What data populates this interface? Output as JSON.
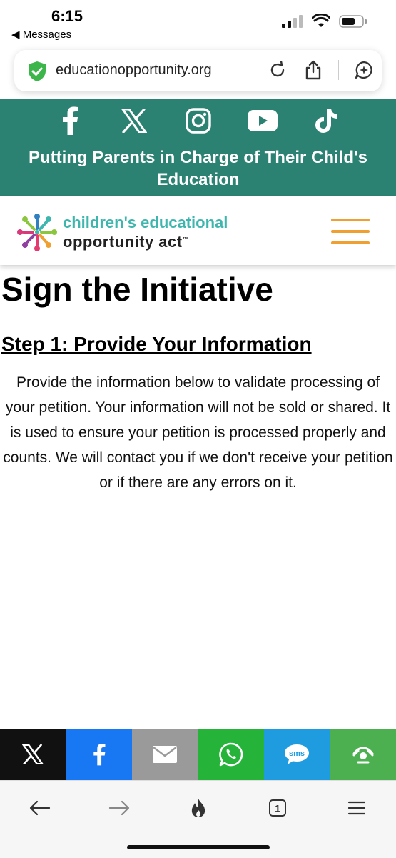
{
  "status": {
    "time": "6:15",
    "back_label": "◀ Messages",
    "battery_color": "#111111"
  },
  "browser": {
    "url": "educationopportunity.org",
    "icons": [
      "shield-check-icon",
      "reload-icon",
      "share-icon",
      "ai-sparkle-icon"
    ]
  },
  "banner": {
    "background": "#2b8272",
    "social": [
      "facebook-icon",
      "x-icon",
      "instagram-icon",
      "youtube-icon",
      "tiktok-icon"
    ],
    "tagline": "Putting Parents in Charge of Their Child's Education"
  },
  "header": {
    "logo_line1": "children's educational",
    "logo_line2": "opportunity act",
    "logo_tm": "™",
    "logo_color": "#3fb6ad",
    "menu_color": "#f0a030"
  },
  "content": {
    "title": "Sign the Initiative",
    "step_title": "Step 1: Provide Your Information",
    "intro": "Provide the information below to validate processing of your petition. Your information will not be sold or shared. It is used to ensure your petition is processed properly and counts. We will contact you if we don't receive your petition or if there are any errors on it."
  },
  "share_bar": [
    {
      "icon": "x-icon",
      "color": "#111111"
    },
    {
      "icon": "facebook-icon",
      "color": "#1877f2"
    },
    {
      "icon": "email-icon",
      "color": "#9a9a9a"
    },
    {
      "icon": "whatsapp-icon",
      "color": "#25b33a"
    },
    {
      "icon": "sms-icon",
      "color": "#1f9be0"
    },
    {
      "icon": "more-share-icon",
      "color": "#4caf50"
    }
  ],
  "sms_label": "sms",
  "bottom_nav": {
    "tab_count": "1",
    "icons": [
      "back-arrow-icon",
      "forward-arrow-icon",
      "flame-icon",
      "tabs-icon",
      "menu-icon"
    ]
  }
}
